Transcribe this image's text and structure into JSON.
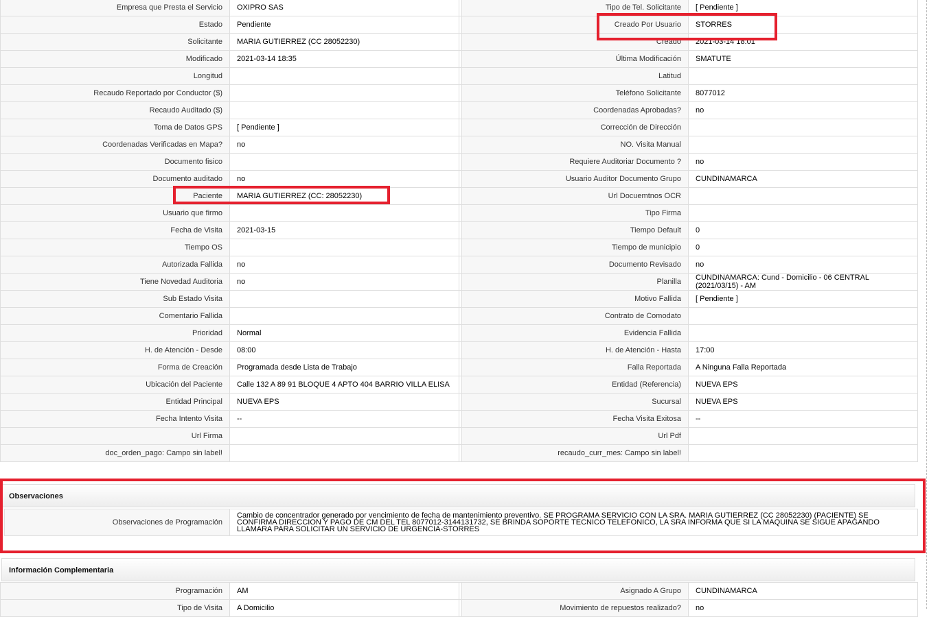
{
  "rows": [
    {
      "l1": "Empresa que Presta el Servicio",
      "v1": "OXIPRO SAS",
      "l2": "Tipo de Tel. Solicitante",
      "v2": "[ Pendiente ]"
    },
    {
      "l1": "Estado",
      "v1": "Pendiente",
      "l2": "Creado Por Usuario",
      "v2": "STORRES"
    },
    {
      "l1": "Solicitante",
      "v1": "MARIA GUTIERREZ (CC 28052230)",
      "l2": "Creado",
      "v2": "2021-03-14 18:01"
    },
    {
      "l1": "Modificado",
      "v1": "2021-03-14 18:35",
      "l2": "Última Modificación",
      "v2": " SMATUTE"
    },
    {
      "l1": "Longitud",
      "v1": "",
      "l2": "Latitud",
      "v2": ""
    },
    {
      "l1": "Recaudo Reportado por Conductor ($)",
      "v1": "",
      "l2": "Teléfono Solicitante",
      "v2": "8077012"
    },
    {
      "l1": "Recaudo Auditado ($)",
      "v1": "",
      "l2": "Coordenadas Aprobadas?",
      "v2": " no"
    },
    {
      "l1": "Toma de Datos GPS",
      "v1": "[ Pendiente ]",
      "l2": "Corrección de Dirección",
      "v2": ""
    },
    {
      "l1": "Coordenadas Verificadas en Mapa?",
      "v1": " no",
      "l2": "NO. Visita Manual",
      "v2": ""
    },
    {
      "l1": "Documento fisico",
      "v1": "",
      "l2": "Requiere Auditoriar Documento ?",
      "v2": " no"
    },
    {
      "l1": "Documento auditado",
      "v1": "no",
      "l2": "Usuario Auditor Documento Grupo",
      "v2": "CUNDINAMARCA"
    },
    {
      "l1": "Paciente",
      "v1": "MARIA GUTIERREZ (CC: 28052230)",
      "l2": "Url Docuemtnos OCR",
      "v2": ""
    },
    {
      "l1": "Usuario que firmo",
      "v1": "",
      "l2": "Tipo Firma",
      "v2": ""
    },
    {
      "l1": "Fecha de Visita",
      "v1": " 2021-03-15",
      "l2": "Tiempo Default",
      "v2": "0"
    },
    {
      "l1": "Tiempo OS",
      "v1": "",
      "l2": "Tiempo de municipio",
      "v2": "0"
    },
    {
      "l1": "Autorizada Fallida",
      "v1": " no",
      "l2": "Documento Revisado",
      "v2": " no"
    },
    {
      "l1": "Tiene Novedad Auditoria",
      "v1": " no",
      "l2": "Planilla",
      "v2": "CUNDINAMARCA: Cund - Domicilio - 06 CENTRAL (2021/03/15) - AM"
    },
    {
      "l1": "Sub Estado Visita",
      "v1": "",
      "l2": "Motivo Fallida",
      "v2": "[ Pendiente ]"
    },
    {
      "l1": "Comentario Fallida",
      "v1": "",
      "l2": "Contrato de Comodato",
      "v2": ""
    },
    {
      "l1": "Prioridad",
      "v1": "Normal",
      "l2": "Evidencia Fallida",
      "v2": ""
    },
    {
      "l1": "H. de Atención - Desde",
      "v1": "08:00",
      "l2": "H. de Atención - Hasta",
      "v2": "17:00"
    },
    {
      "l1": "Forma de Creación",
      "v1": "Programada desde Lista de Trabajo",
      "l2": "Falla Reportada",
      "v2": "A Ninguna Falla Reportada"
    },
    {
      "l1": "Ubicación del Paciente",
      "v1": "Calle 132 A 89 91 BLOQUE 4 APTO 404 BARRIO VILLA ELISA",
      "l2": "Entidad (Referencia)",
      "v2": "NUEVA EPS"
    },
    {
      "l1": "Entidad Principal",
      "v1": "NUEVA EPS",
      "l2": "Sucursal",
      "v2": "NUEVA EPS"
    },
    {
      "l1": "Fecha Intento Visita",
      "v1": " --",
      "l2": "Fecha Visita Exitosa",
      "v2": " --"
    },
    {
      "l1": "Url Firma",
      "v1": "",
      "l2": "Url Pdf",
      "v2": ""
    },
    {
      "l1": "doc_orden_pago: Campo sin label!",
      "v1": "",
      "l2": "recaudo_curr_mes: Campo sin label!",
      "v2": ""
    }
  ],
  "observaciones": {
    "title": "Observaciones",
    "label": "Observaciones de Programación",
    "value": "   Cambio de concentrador generado por vencimiento de fecha de mantenimiento preventivo. SE PROGRAMA SERVICIO CON LA SRA. MARIA GUTIERREZ (CC 28052230) (PACIENTE) SE CONFIRMA DIRECCION Y PAGO DE CM DEL TEL 8077012-3144131732, SE BRINDA SOPORTE TECNICO TELEFONICO, LA SRA INFORMA QUE SI LA MAQUINA SE SIGUE APAGANDO LLAMARA PARA SOLICITAR UN SERVICIO DE URGENCIA-STORRES"
  },
  "complementaria": {
    "title": "Información Complementaria",
    "rows": [
      {
        "l1": "Programación",
        "v1": "AM",
        "l2": "Asignado A Grupo",
        "v2": "CUNDINAMARCA"
      },
      {
        "l1": "Tipo de Visita",
        "v1": "A Domicilio",
        "l2": "Movimiento de repuestos realizado?",
        "v2": " no"
      }
    ]
  },
  "highlight_color": "#e5202e"
}
